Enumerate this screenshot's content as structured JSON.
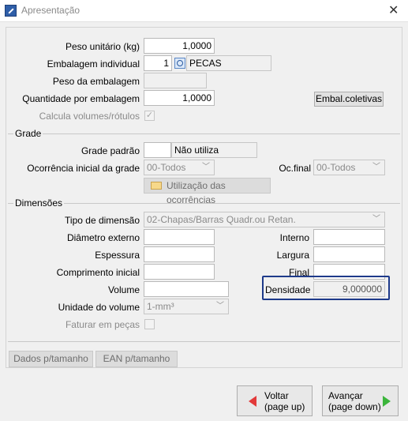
{
  "window": {
    "title": "Apresentação",
    "close": "✕"
  },
  "fields": {
    "peso_unitario": {
      "label": "Peso unitário (kg)",
      "value": "1,0000"
    },
    "embalagem_individual": {
      "label": "Embalagem individual",
      "qty": "1",
      "value": "PECAS"
    },
    "peso_embalagem": {
      "label": "Peso da embalagem",
      "value": ""
    },
    "quantidade_embalagem": {
      "label": "Quantidade por embalagem",
      "value": "1,0000"
    },
    "calcula_volumes": {
      "label": "Calcula volumes/rótulos",
      "checked": "✓"
    },
    "embal_coletivas": "Embal.coletivas"
  },
  "grade": {
    "section": "Grade",
    "grade_padrao": {
      "label": "Grade padrão",
      "value": "",
      "desc": "Não utiliza"
    },
    "ocorrencia_inicial": {
      "label": "Ocorrência inicial da grade",
      "value": "00-Todos"
    },
    "oc_final": {
      "label": "Oc.final",
      "value": "00-Todos"
    },
    "utilizacao_button": "Utilização das ocorrências"
  },
  "dimensoes": {
    "section": "Dimensões",
    "tipo_dimensao": {
      "label": "Tipo de dimensão",
      "value": "02-Chapas/Barras Quadr.ou Retan."
    },
    "diametro_externo": {
      "label": "Diâmetro externo",
      "value": ""
    },
    "interno": {
      "label": "Interno",
      "value": ""
    },
    "espessura": {
      "label": "Espessura",
      "value": ""
    },
    "largura": {
      "label": "Largura",
      "value": ""
    },
    "comprimento_inicial": {
      "label": "Comprimento inicial",
      "value": ""
    },
    "final": {
      "label": "Final",
      "value": ""
    },
    "volume": {
      "label": "Volume",
      "value": ""
    },
    "densidade": {
      "label": "Densidade",
      "value": "9,000000"
    },
    "unidade_volume": {
      "label": "Unidade do volume",
      "value": "1-mm³"
    },
    "faturar_pecas": {
      "label": "Faturar em peças"
    }
  },
  "bottom_buttons": {
    "dados_tamanho": "Dados p/tamanho",
    "ean_tamanho": "EAN p/tamanho"
  },
  "nav": {
    "voltar": {
      "line1": "Voltar",
      "line2": "(page up)"
    },
    "avancar": {
      "line1": "Avançar",
      "line2": "(page down)"
    }
  }
}
